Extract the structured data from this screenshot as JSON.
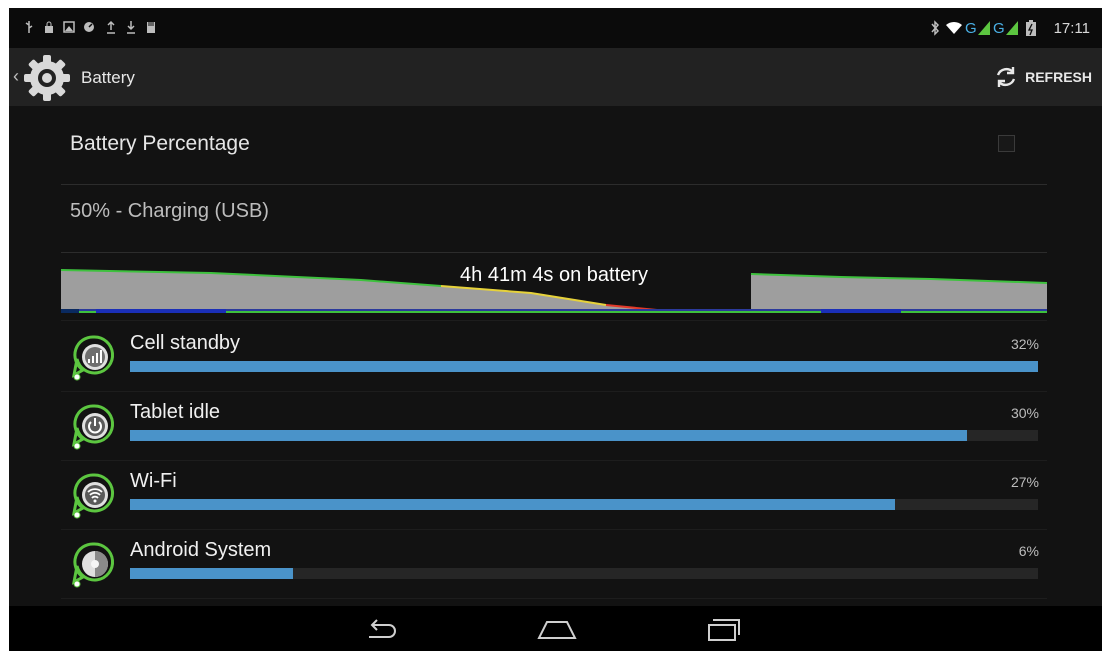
{
  "status_bar": {
    "time": "17:11",
    "left_icons": [
      "usb-icon",
      "lock-icon",
      "image-icon",
      "app-icon",
      "upload-icon",
      "download-icon",
      "storage-icon"
    ],
    "right_icons": [
      "bluetooth-icon",
      "wifi-icon",
      "signal-g-icon",
      "signal-g-icon",
      "battery-charging-icon"
    ],
    "network_label_1": "G",
    "network_label_2": "G"
  },
  "header": {
    "title": "Battery",
    "refresh_label": "REFRESH"
  },
  "settings": {
    "battery_percentage_label": "Battery Percentage",
    "battery_percentage_checked": false,
    "battery_status": "50% - Charging (USB)"
  },
  "graph": {
    "label": "4h 41m 4s on battery"
  },
  "usage": [
    {
      "name": "Cell standby",
      "percent_label": "32%",
      "fill": 1.0,
      "icon": "signal-bars-icon"
    },
    {
      "name": "Tablet idle",
      "percent_label": "30%",
      "fill": 0.922,
      "icon": "power-icon"
    },
    {
      "name": "Wi-Fi",
      "percent_label": "27%",
      "fill": 0.843,
      "icon": "wifi-icon"
    },
    {
      "name": "Android System",
      "percent_label": "6%",
      "fill": 0.18,
      "icon": "android-system-icon"
    }
  ],
  "colors": {
    "accent": "#4a93c9",
    "graph_line": "#3ec13e",
    "graph_fill": "#9e9e9e",
    "icon_green": "#5cc640"
  },
  "nav": [
    "back-icon",
    "home-icon",
    "recent-apps-icon"
  ]
}
